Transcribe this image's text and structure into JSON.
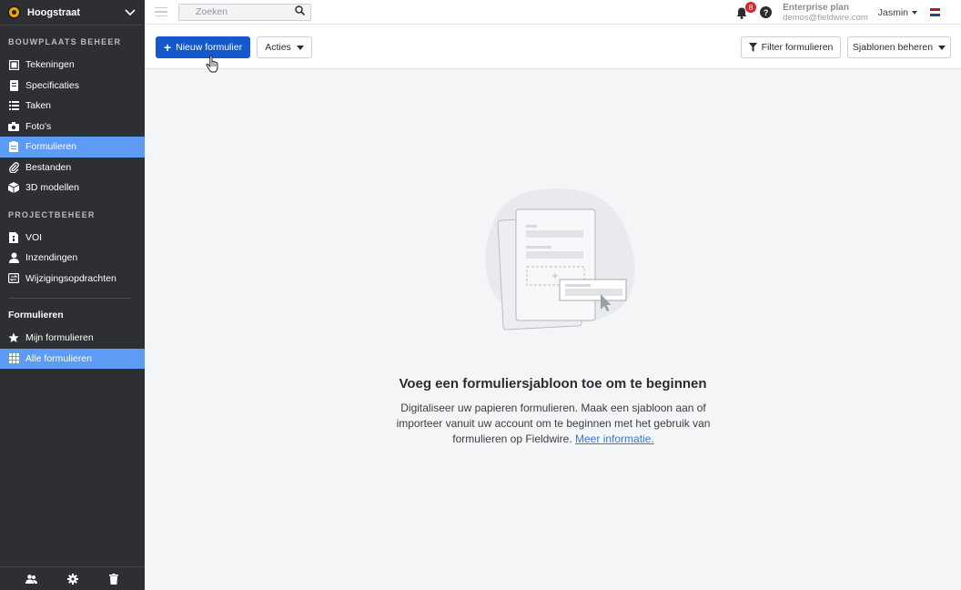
{
  "sidebar": {
    "project_name": "Hoogstraat",
    "section1_title": "BOUWPLAATS BEHEER",
    "section1_items": [
      {
        "label": "Tekeningen",
        "icon": "drawings-icon"
      },
      {
        "label": "Specificaties",
        "icon": "specifications-icon"
      },
      {
        "label": "Taken",
        "icon": "tasks-icon"
      },
      {
        "label": "Foto's",
        "icon": "camera-icon"
      },
      {
        "label": "Formulieren",
        "icon": "forms-icon",
        "active": true
      },
      {
        "label": "Bestanden",
        "icon": "paperclip-icon"
      },
      {
        "label": "3D modellen",
        "icon": "cube-icon"
      }
    ],
    "section2_title": "PROJECTBEHEER",
    "section2_items": [
      {
        "label": "VOI",
        "icon": "rfi-icon"
      },
      {
        "label": "Inzendingen",
        "icon": "submittals-icon"
      },
      {
        "label": "Wijzigingsopdrachten",
        "icon": "change-orders-icon"
      }
    ],
    "forms_title": "Formulieren",
    "forms_items": [
      {
        "label": "Mijn formulieren",
        "icon": "star-icon"
      },
      {
        "label": "Alle formulieren",
        "icon": "grid-icon",
        "active": true
      }
    ],
    "bottom_icons": [
      "people-icon",
      "gear-icon",
      "trash-icon"
    ]
  },
  "topbar": {
    "search_placeholder": "Zoeken",
    "notification_count": "8",
    "help_label": "?",
    "plan_name": "Enterprise plan",
    "plan_email": "demos@fieldwire.com",
    "user_name": "Jasmin"
  },
  "toolbar": {
    "new_form_label": "Nieuw formulier",
    "actions_label": "Acties",
    "filter_label": "Filter formulieren",
    "templates_label": "Sjablonen beheren"
  },
  "empty_state": {
    "title": "Voeg een formuliersjabloon toe om te beginnen",
    "text": "Digitaliseer uw papieren formulieren. Maak een sjabloon aan of importeer vanuit uw account om te beginnen met het gebruik van formulieren op Fieldwire.",
    "link_label": "Meer informatie."
  },
  "colors": {
    "sidebar_bg": "#2d2f33",
    "active_bg": "#5d9bf6",
    "primary": "#1557cc",
    "badge": "#d7262d",
    "link": "#3a78d6"
  }
}
